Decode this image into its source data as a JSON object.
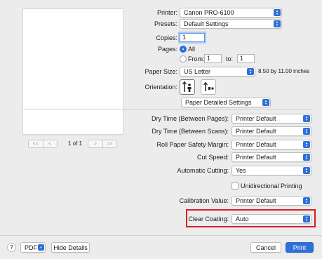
{
  "preview": {
    "page_indicator": "1 of 1",
    "nav_first": "<<",
    "nav_prev": "<",
    "nav_next": ">",
    "nav_last": ">>"
  },
  "printer": {
    "label": "Printer:",
    "value": "Canon PRO-6100"
  },
  "presets": {
    "label": "Presets:",
    "value": "Default Settings"
  },
  "copies": {
    "label": "Copies:",
    "value": "1"
  },
  "pages": {
    "label": "Pages:",
    "all_label": "All",
    "from_label": "From:",
    "from_value": "1",
    "to_label": "to:",
    "to_value": "1",
    "selected": "All"
  },
  "paper_size": {
    "label": "Paper Size:",
    "value": "US Letter",
    "dimensions": "8.50 by 11.00 inches"
  },
  "orientation": {
    "label": "Orientation:",
    "selected": "portrait"
  },
  "section_popup": {
    "value": "Paper Detailed Settings"
  },
  "settings": [
    {
      "label": "Dry Time (Between Pages):",
      "value": "Printer Default"
    },
    {
      "label": "Dry Time (Between Scans):",
      "value": "Printer Default"
    },
    {
      "label": "Roll Paper Safety Margin:",
      "value": "Printer Default"
    },
    {
      "label": "Cut Speed:",
      "value": "Printer Default"
    },
    {
      "label": "Automatic Cutting:",
      "value": "Yes"
    }
  ],
  "unidirectional": {
    "label": "Unidirectional Printing",
    "checked": false
  },
  "calibration": {
    "label": "Calibration Value:",
    "value": "Printer Default"
  },
  "clear_coating": {
    "label": "Clear Coating:",
    "value": "Auto",
    "highlight_color": "#d8202a"
  },
  "footer": {
    "help": "?",
    "pdf": "PDF",
    "hide_details": "Hide Details",
    "cancel": "Cancel",
    "print": "Print"
  },
  "colors": {
    "accent": "#2f6fd8",
    "background": "#ececec"
  }
}
